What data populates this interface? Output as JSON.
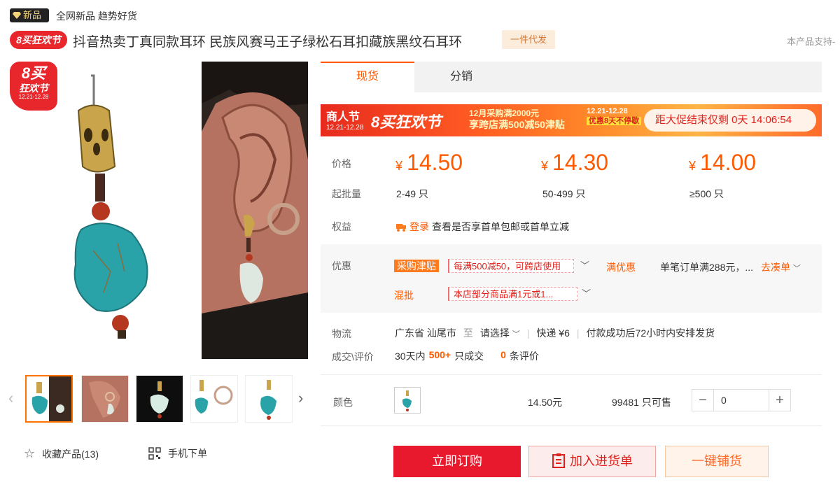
{
  "header": {
    "new_badge": "新品",
    "tagline": "全网新品 趋势好货",
    "festival_pill": "8买狂欢节",
    "title": "抖音热卖丁真同款耳环 民族风赛马王子绿松石耳扣藏族黑纹石耳环",
    "dropship_tag": "一件代发",
    "support_text": "本产品支持-"
  },
  "gallery": {
    "badge_main": "8买",
    "badge_sub": "狂欢节",
    "badge_date": "12.21-12.28",
    "favorite_label": "收藏产品(13)",
    "mobile_label": "手机下单"
  },
  "tabs": [
    {
      "label": "现货"
    },
    {
      "label": "分销"
    }
  ],
  "banner": {
    "left_title": "商人节",
    "left_date": "12.21-12.28",
    "festival": "8买狂欢节",
    "line1": "12月采购满2000元",
    "line2": "享跨店满500减50津贴",
    "date_range": "12.21-12.28",
    "tag": "优惠8天不停歇",
    "countdown": "距大促结束仅剩 0天 14:06:54"
  },
  "pricing": {
    "price_label": "价格",
    "qty_label": "起批量",
    "currency": "¥",
    "tiers": [
      {
        "price": "14.50",
        "qty": "2-49 只"
      },
      {
        "price": "14.30",
        "qty": "50-499 只"
      },
      {
        "price": "14.00",
        "qty": "≥500 只"
      }
    ],
    "rights_label": "权益",
    "login": "登录",
    "rights_text": "查看是否享首单包邮或首单立减"
  },
  "promotions": {
    "label": "优惠",
    "subsidy_tag": "采购津贴",
    "subsidy_coupon": "每满500减50，可跨店使用",
    "full_discount": "满优惠",
    "full_discount_text": "单笔订单满288元，...",
    "go_collect": "去凑单",
    "mixed_label": "混批",
    "mixed_coupon": "本店部分商品满1元或1..."
  },
  "logistics": {
    "label": "物流",
    "origin": "广东省 汕尾市",
    "to": "至",
    "destination": "请选择",
    "express": "快递 ¥6",
    "ship_note": "付款成功后72小时内安排发货",
    "deal_label": "成交\\评价",
    "deal_prefix": "30天内",
    "deal_count": "500+",
    "deal_suffix": "只成交",
    "review_count": "0",
    "review_suffix": "条评价"
  },
  "variant": {
    "label": "颜色",
    "price": "14.50元",
    "stock": "99481 只可售",
    "minus": "−",
    "plus": "+",
    "quantity": "0"
  },
  "actions": {
    "buy_now": "立即订购",
    "add_cart": "加入进货单",
    "distribute": "一键铺货"
  },
  "colors": {
    "accent": "#ff5a00",
    "buy": "#e8192c",
    "festival_red": "#e8272d"
  }
}
